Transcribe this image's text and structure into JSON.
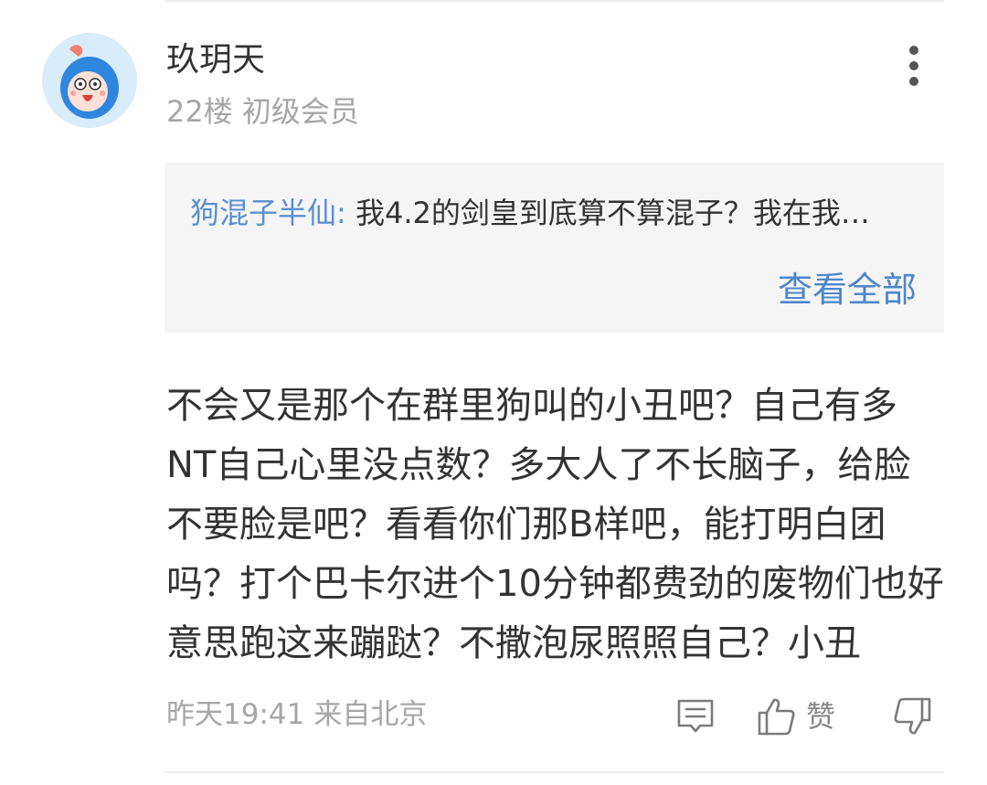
{
  "comment": {
    "username": "玖玥天",
    "floor": "22楼",
    "member_level": "初级会员",
    "avatar_icon": "cartoon-avatar-icon",
    "more_icon": "more-vertical-icon",
    "quote": {
      "author": "狗混子半仙:",
      "text": "我4.2的剑皇到底算不算混子？我在我…",
      "view_all": "查看全部"
    },
    "body_lines": [
      "不会又是那个在群里狗叫的小丑吧？自己有多",
      "NT自己心里没点数？多大人了不长脑子，给脸",
      "不要脸是吧？看看你们那B样吧，能打明白团",
      "吗？打个巴卡尔进个10分钟都费劲的废物们也好",
      "意思跑这来蹦跶？不撒泡尿照照自己？小丑"
    ],
    "timestamp": "昨天19:41",
    "location": "来自北京",
    "actions": {
      "reply_icon": "comment-icon",
      "like_icon": "thumbs-up-icon",
      "like_label": "赞",
      "dislike_icon": "thumbs-down-icon"
    },
    "colors": {
      "link_blue": "#4d86cc",
      "quote_background": "#f5f5f5",
      "secondary_text": "#a6a6a6",
      "avatar_background": "#d9ecf9"
    }
  }
}
